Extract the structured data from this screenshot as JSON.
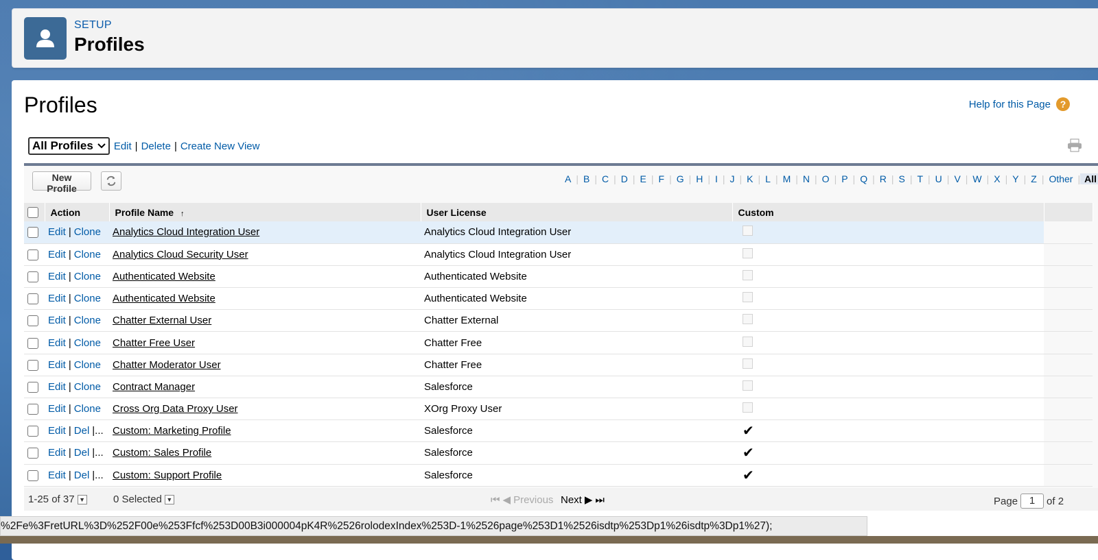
{
  "header": {
    "eyebrow": "SETUP",
    "title": "Profiles",
    "icon": "user-icon"
  },
  "page": {
    "title": "Profiles",
    "help_link": "Help for this Page"
  },
  "view_bar": {
    "selected_view": "All Profiles",
    "edit": "Edit",
    "delete": "Delete",
    "create_new_view": "Create New View"
  },
  "toolbar": {
    "new_profile": "New Profile",
    "alphabet": [
      "A",
      "B",
      "C",
      "D",
      "E",
      "F",
      "G",
      "H",
      "I",
      "J",
      "K",
      "L",
      "M",
      "N",
      "O",
      "P",
      "Q",
      "R",
      "S",
      "T",
      "U",
      "V",
      "W",
      "X",
      "Y",
      "Z",
      "Other",
      "All"
    ],
    "active_letter": "All"
  },
  "table": {
    "columns": {
      "action": "Action",
      "profile_name": "Profile Name",
      "sort_indicator": "↑",
      "user_license": "User License",
      "custom": "Custom"
    },
    "rows": [
      {
        "actions": [
          "Edit",
          "Clone"
        ],
        "name": "Analytics Cloud Integration User",
        "license": "Analytics Cloud Integration User",
        "custom": false,
        "highlight": true
      },
      {
        "actions": [
          "Edit",
          "Clone"
        ],
        "name": "Analytics Cloud Security User",
        "license": "Analytics Cloud Integration User",
        "custom": false
      },
      {
        "actions": [
          "Edit",
          "Clone"
        ],
        "name": "Authenticated Website",
        "license": "Authenticated Website",
        "custom": false
      },
      {
        "actions": [
          "Edit",
          "Clone"
        ],
        "name": "Authenticated Website",
        "license": "Authenticated Website",
        "custom": false
      },
      {
        "actions": [
          "Edit",
          "Clone"
        ],
        "name": "Chatter External User",
        "license": "Chatter External",
        "custom": false
      },
      {
        "actions": [
          "Edit",
          "Clone"
        ],
        "name": "Chatter Free User",
        "license": "Chatter Free",
        "custom": false
      },
      {
        "actions": [
          "Edit",
          "Clone"
        ],
        "name": "Chatter Moderator User",
        "license": "Chatter Free",
        "custom": false
      },
      {
        "actions": [
          "Edit",
          "Clone"
        ],
        "name": "Contract Manager",
        "license": "Salesforce",
        "custom": false
      },
      {
        "actions": [
          "Edit",
          "Clone"
        ],
        "name": "Cross Org Data Proxy User",
        "license": "XOrg Proxy User",
        "custom": false
      },
      {
        "actions": [
          "Edit",
          "Del"
        ],
        "more": "|...",
        "name": "Custom: Marketing Profile",
        "license": "Salesforce",
        "custom": true
      },
      {
        "actions": [
          "Edit",
          "Del"
        ],
        "more": "|...",
        "name": "Custom: Sales Profile",
        "license": "Salesforce",
        "custom": true
      },
      {
        "actions": [
          "Edit",
          "Del"
        ],
        "more": "|...",
        "name": "Custom: Support Profile",
        "license": "Salesforce",
        "custom": true
      }
    ]
  },
  "footer": {
    "range": "1-25 of 37",
    "selected": "0 Selected",
    "previous": "Previous",
    "next": "Next",
    "page_label": "Page",
    "page_value": "1",
    "page_total": "of 2"
  },
  "status_url": "%2Fe%3FretURL%3D%252F00e%253Ffcf%253D00B3i000004pK4R%2526rolodexIndex%253D-1%2526page%253D1%2526isdtp%253Dp1%26isdtp%3Dp1%27);",
  "colors": {
    "link": "#015ba7",
    "header_icon_bg": "#3c6a96",
    "help_icon": "#e39a2b"
  }
}
